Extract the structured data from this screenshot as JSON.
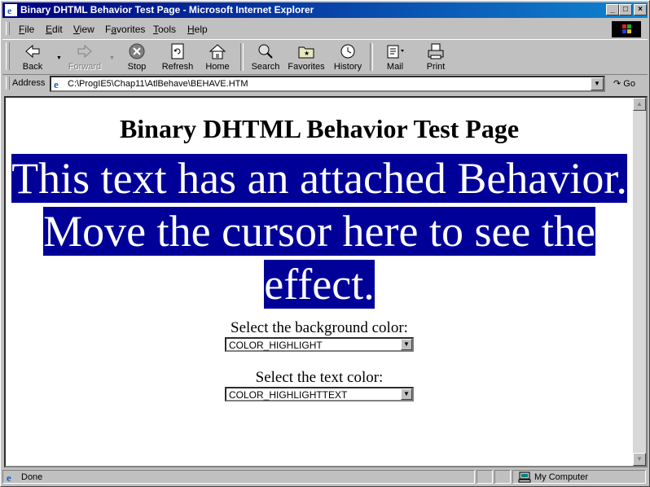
{
  "window": {
    "title": "Binary DHTML Behavior Test Page - Microsoft Internet Explorer"
  },
  "menu": [
    {
      "label": "File",
      "accel": "F"
    },
    {
      "label": "Edit",
      "accel": "E"
    },
    {
      "label": "View",
      "accel": "V"
    },
    {
      "label": "Favorites",
      "accel": "a"
    },
    {
      "label": "Tools",
      "accel": "T"
    },
    {
      "label": "Help",
      "accel": "H"
    }
  ],
  "toolbar": {
    "back": "Back",
    "forward": "Forward",
    "stop": "Stop",
    "refresh": "Refresh",
    "home": "Home",
    "search": "Search",
    "favorites": "Favorites",
    "history": "History",
    "mail": "Mail",
    "print": "Print"
  },
  "address": {
    "label": "Address",
    "url": "C:\\ProgIE5\\Chap11\\AtlBehave\\BEHAVE.HTM",
    "go": "Go"
  },
  "page": {
    "heading": "Binary DHTML Behavior Test Page",
    "behavior_text": "This text has an attached Behavior. Move the cursor here to see the effect.",
    "bg_label": "Select the background color:",
    "bg_value": "COLOR_HIGHLIGHT",
    "text_label": "Select the text color:",
    "text_value": "COLOR_HIGHLIGHTTEXT",
    "highlight_color": "#000099"
  },
  "status": {
    "text": "Done",
    "zone": "My Computer"
  }
}
